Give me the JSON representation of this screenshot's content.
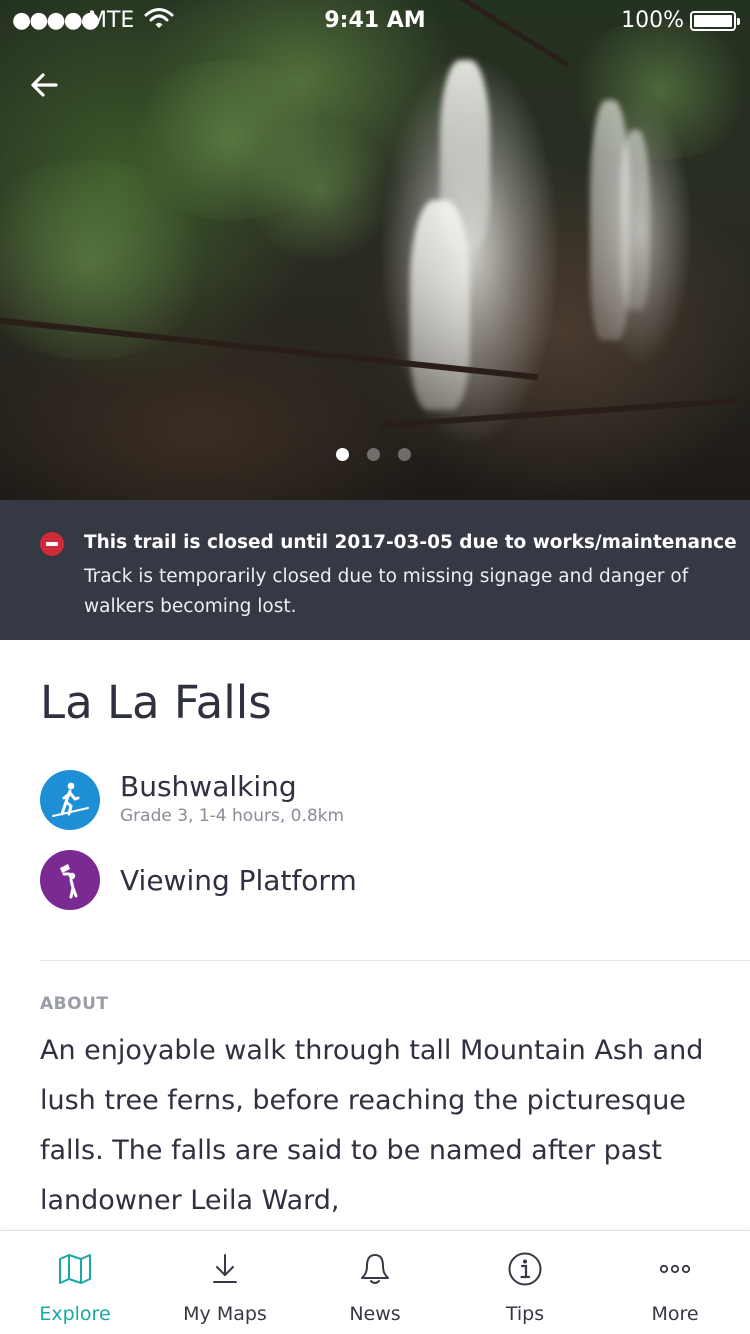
{
  "status_bar": {
    "signal": "●●●●●",
    "carrier": "MTE",
    "time": "9:41 AM",
    "battery": "100%"
  },
  "hero": {
    "image_icon": "waterfall-photo",
    "carousel_pages": 3,
    "carousel_active": 1
  },
  "alert": {
    "icon": "no-entry-icon",
    "title": "This trail is closed until 2017-03-05 due to works/maintenance",
    "body": "Track is temporarily closed due to missing signage and danger of walkers becoming lost."
  },
  "place": {
    "title": "La La Falls"
  },
  "activities": [
    {
      "name": "Bushwalking",
      "detail": "Grade 3, 1-4 hours, 0.8km",
      "icon": "hiker-icon",
      "color": "#1e8fd6"
    },
    {
      "name": "Viewing Platform",
      "detail": "",
      "icon": "binoculars-viewer-icon",
      "color": "#7b2a92"
    }
  ],
  "about": {
    "label": "ABOUT",
    "text": "An enjoyable walk through tall Mountain Ash and lush tree ferns, before reaching the picturesque falls.  The falls are said to be named after past landowner Leila Ward,"
  },
  "tabs": [
    {
      "label": "Explore",
      "icon": "map-icon",
      "active": true
    },
    {
      "label": "My Maps",
      "icon": "download-icon",
      "active": false
    },
    {
      "label": "News",
      "icon": "bell-icon",
      "active": false
    },
    {
      "label": "Tips",
      "icon": "info-icon",
      "active": false
    },
    {
      "label": "More",
      "icon": "more-dots-icon",
      "active": false
    }
  ],
  "colors": {
    "accent": "#1aa8a2",
    "alert_bg": "#363843",
    "alert_icon": "#cf2a39",
    "text": "#2f3140",
    "muted": "#8a8c98"
  }
}
